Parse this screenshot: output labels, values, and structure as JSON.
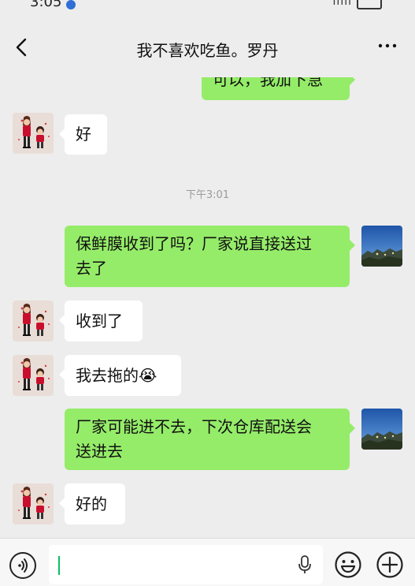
{
  "status_bar": {
    "time": "3:05"
  },
  "header": {
    "title": "我不喜欢吃鱼。罗丹"
  },
  "messages": [
    {
      "side": "out",
      "text": "可以，我加下急"
    },
    {
      "side": "in",
      "text": "好"
    },
    {
      "type": "time",
      "text": "下午3:01"
    },
    {
      "side": "out",
      "line1": "保鲜膜收到了吗？厂家说直接送过",
      "line2": "去了"
    },
    {
      "side": "in",
      "text": "收到了"
    },
    {
      "side": "in",
      "text": "我去拖的",
      "emoji": "😭"
    },
    {
      "side": "out",
      "line1": "厂家可能进不去，下次仓库配送会",
      "line2": "送进去"
    },
    {
      "side": "in",
      "text": "好的"
    }
  ],
  "icons": {
    "back": "chevron-left-icon",
    "more": "more-dots-icon",
    "voice": "voice-icon",
    "mic": "microphone-icon",
    "emoji": "emoji-smile-icon",
    "plus": "plus-circle-icon"
  },
  "colors": {
    "background": "#ededed",
    "bubble_out": "#95ec69",
    "bubble_in": "#ffffff",
    "caret": "#07c160"
  }
}
